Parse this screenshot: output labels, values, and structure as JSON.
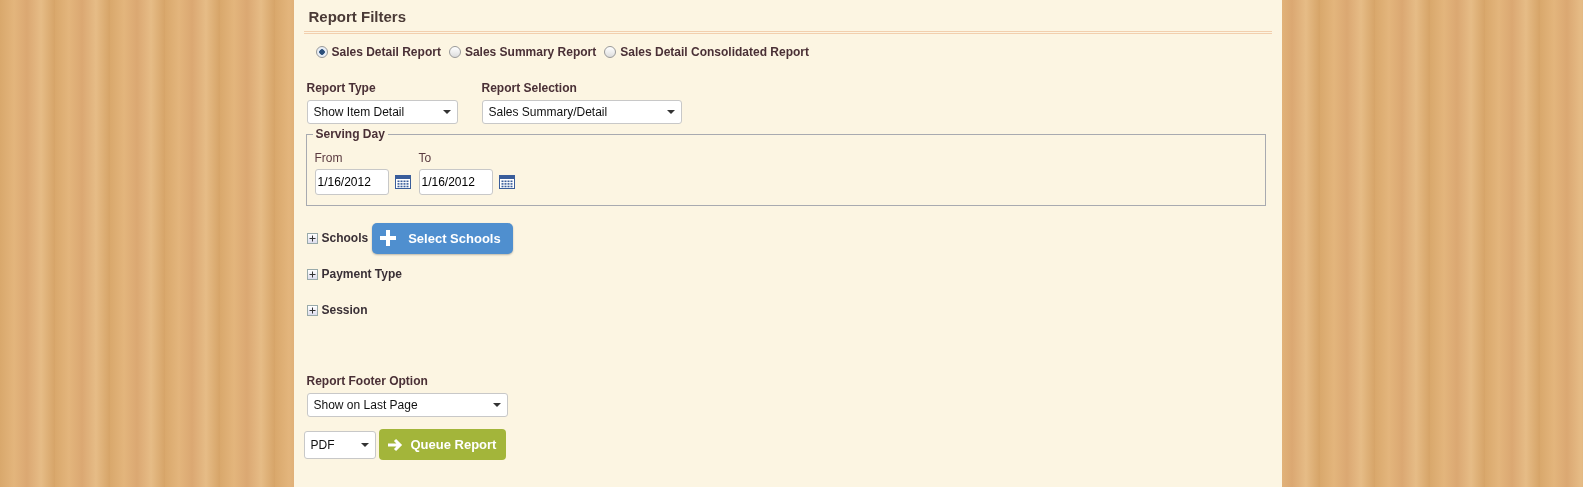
{
  "title": "Report Filters",
  "report_kinds": [
    {
      "label": "Sales Detail Report",
      "selected": true
    },
    {
      "label": "Sales Summary Report",
      "selected": false
    },
    {
      "label": "Sales Detail Consolidated Report",
      "selected": false
    }
  ],
  "report_type": {
    "label": "Report Type",
    "value": "Show Item Detail"
  },
  "report_selection": {
    "label": "Report Selection",
    "value": "Sales Summary/Detail"
  },
  "serving_day": {
    "legend": "Serving Day",
    "from": {
      "label": "From",
      "value": "1/16/2012"
    },
    "to": {
      "label": "To",
      "value": "1/16/2012"
    }
  },
  "sections": [
    {
      "label": "Schools",
      "expanded": false,
      "button": "Select Schools"
    },
    {
      "label": "Payment Type",
      "expanded": false
    },
    {
      "label": "Session",
      "expanded": false
    }
  ],
  "footer_option": {
    "label": "Report Footer Option",
    "value": "Show on Last Page"
  },
  "format": {
    "value": "PDF"
  },
  "queue_button": "Queue Report"
}
